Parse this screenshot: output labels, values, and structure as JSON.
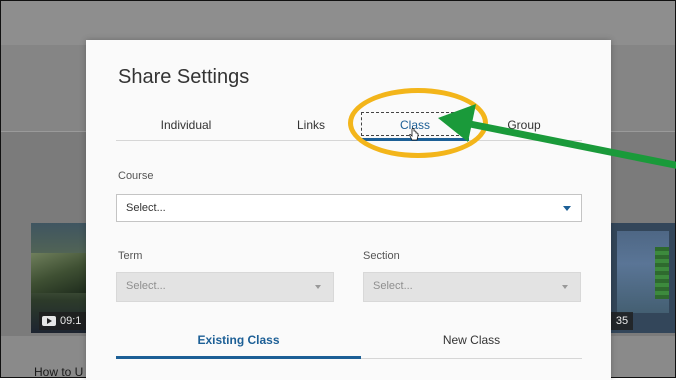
{
  "background": {
    "video_duration_left": "09:1",
    "video_duration_right": "35",
    "caption": "How to U"
  },
  "modal": {
    "title": "Share Settings",
    "tabs": [
      {
        "label": "Individual"
      },
      {
        "label": "Links"
      },
      {
        "label": "Class",
        "active": true
      },
      {
        "label": "Group"
      }
    ],
    "course": {
      "label": "Course",
      "placeholder": "Select..."
    },
    "term": {
      "label": "Term",
      "placeholder": "Select..."
    },
    "section": {
      "label": "Section",
      "placeholder": "Select..."
    },
    "sub_tabs": [
      {
        "label": "Existing Class",
        "active": true
      },
      {
        "label": "New Class"
      }
    ]
  },
  "annotation": {
    "highlight_color": "#f3b51a",
    "arrow_color": "#1a9a3a"
  },
  "colors": {
    "accent": "#1c5f96"
  }
}
